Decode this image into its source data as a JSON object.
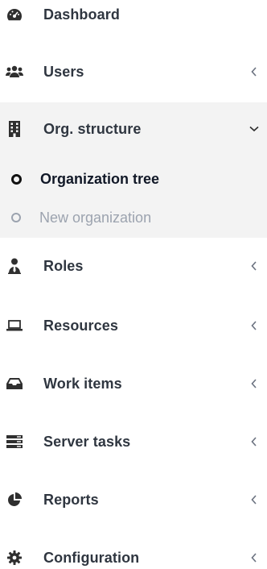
{
  "sidebar": {
    "items": [
      {
        "label": "Dashboard",
        "icon": "dashboard-icon"
      },
      {
        "label": "Users",
        "icon": "users-icon"
      },
      {
        "label": "Org. structure",
        "icon": "building-icon"
      },
      {
        "label": "Roles",
        "icon": "user-tie-icon"
      },
      {
        "label": "Resources",
        "icon": "laptop-icon"
      },
      {
        "label": "Work items",
        "icon": "inbox-icon"
      },
      {
        "label": "Server tasks",
        "icon": "server-icon"
      },
      {
        "label": "Reports",
        "icon": "pie-chart-icon"
      },
      {
        "label": "Configuration",
        "icon": "gear-icon"
      }
    ],
    "submenu": [
      {
        "label": "Organization tree",
        "active": true
      },
      {
        "label": "New organization",
        "active": false
      }
    ]
  }
}
